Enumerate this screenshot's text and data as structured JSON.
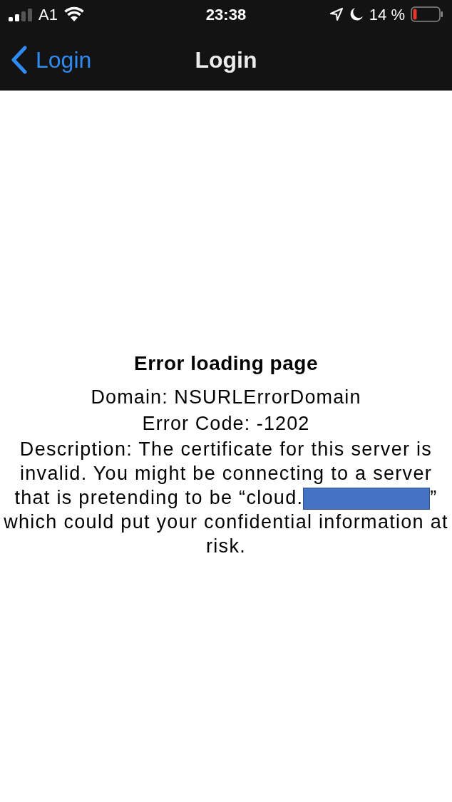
{
  "status_bar": {
    "carrier": "A1",
    "time": "23:38",
    "battery": "14 %"
  },
  "nav_bar": {
    "back_label": "Login",
    "title": "Login"
  },
  "error": {
    "title": "Error loading page",
    "lines": [
      "Domain: NSURLErrorDomain",
      "Error Code: -1202"
    ],
    "description": {
      "before": "Description: The certificate for this server is invalid. You might be connecting to a server that is pretending to be “cloud.",
      "redacted": true,
      "after": "” which could put your confidential information at risk."
    }
  }
}
